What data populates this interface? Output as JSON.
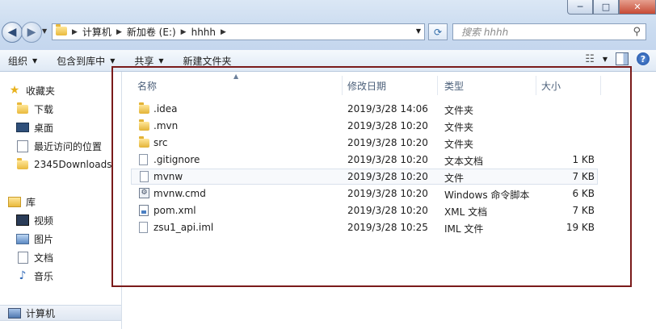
{
  "address": {
    "path": [
      "计算机",
      "新加卷 (E:)",
      "hhhh"
    ]
  },
  "search": {
    "placeholder": "搜索 hhhh"
  },
  "window_buttons": {
    "minimize": "─",
    "maximize": "□",
    "close": "✕"
  },
  "toolbar": {
    "organize": "组织",
    "include_library": "包含到库中",
    "share": "共享",
    "new_folder": "新建文件夹",
    "help": "?"
  },
  "sidebar": {
    "favorites": {
      "label": "收藏夹",
      "items": [
        {
          "label": "下载",
          "icon": "download-folder-icon"
        },
        {
          "label": "桌面",
          "icon": "desktop-icon"
        },
        {
          "label": "最近访问的位置",
          "icon": "recent-places-icon"
        },
        {
          "label": "2345Downloads",
          "icon": "folder-icon"
        }
      ]
    },
    "libraries": {
      "label": "库",
      "items": [
        {
          "label": "视频",
          "icon": "video-icon"
        },
        {
          "label": "图片",
          "icon": "picture-icon"
        },
        {
          "label": "文档",
          "icon": "document-icon"
        },
        {
          "label": "音乐",
          "icon": "music-icon"
        }
      ]
    },
    "computer": {
      "label": "计算机"
    }
  },
  "columns": {
    "name": "名称",
    "modified": "修改日期",
    "type": "类型",
    "size": "大小"
  },
  "files": [
    {
      "name": ".idea",
      "modified": "2019/3/28 14:06",
      "type": "文件夹",
      "size": "",
      "icon": "folder"
    },
    {
      "name": ".mvn",
      "modified": "2019/3/28 10:20",
      "type": "文件夹",
      "size": "",
      "icon": "folder"
    },
    {
      "name": "src",
      "modified": "2019/3/28 10:20",
      "type": "文件夹",
      "size": "",
      "icon": "folder"
    },
    {
      "name": ".gitignore",
      "modified": "2019/3/28 10:20",
      "type": "文本文档",
      "size": "1 KB",
      "icon": "file"
    },
    {
      "name": "mvnw",
      "modified": "2019/3/28 10:20",
      "type": "文件",
      "size": "7 KB",
      "icon": "file"
    },
    {
      "name": "mvnw.cmd",
      "modified": "2019/3/28 10:20",
      "type": "Windows 命令脚本",
      "size": "6 KB",
      "icon": "cmd"
    },
    {
      "name": "pom.xml",
      "modified": "2019/3/28 10:20",
      "type": "XML 文档",
      "size": "7 KB",
      "icon": "xml"
    },
    {
      "name": "zsu1_api.iml",
      "modified": "2019/3/28 10:25",
      "type": "IML 文件",
      "size": "19 KB",
      "icon": "file"
    }
  ],
  "colors": {
    "annotation_box": "#7a1a1a",
    "accent": "#2f6aa8"
  }
}
